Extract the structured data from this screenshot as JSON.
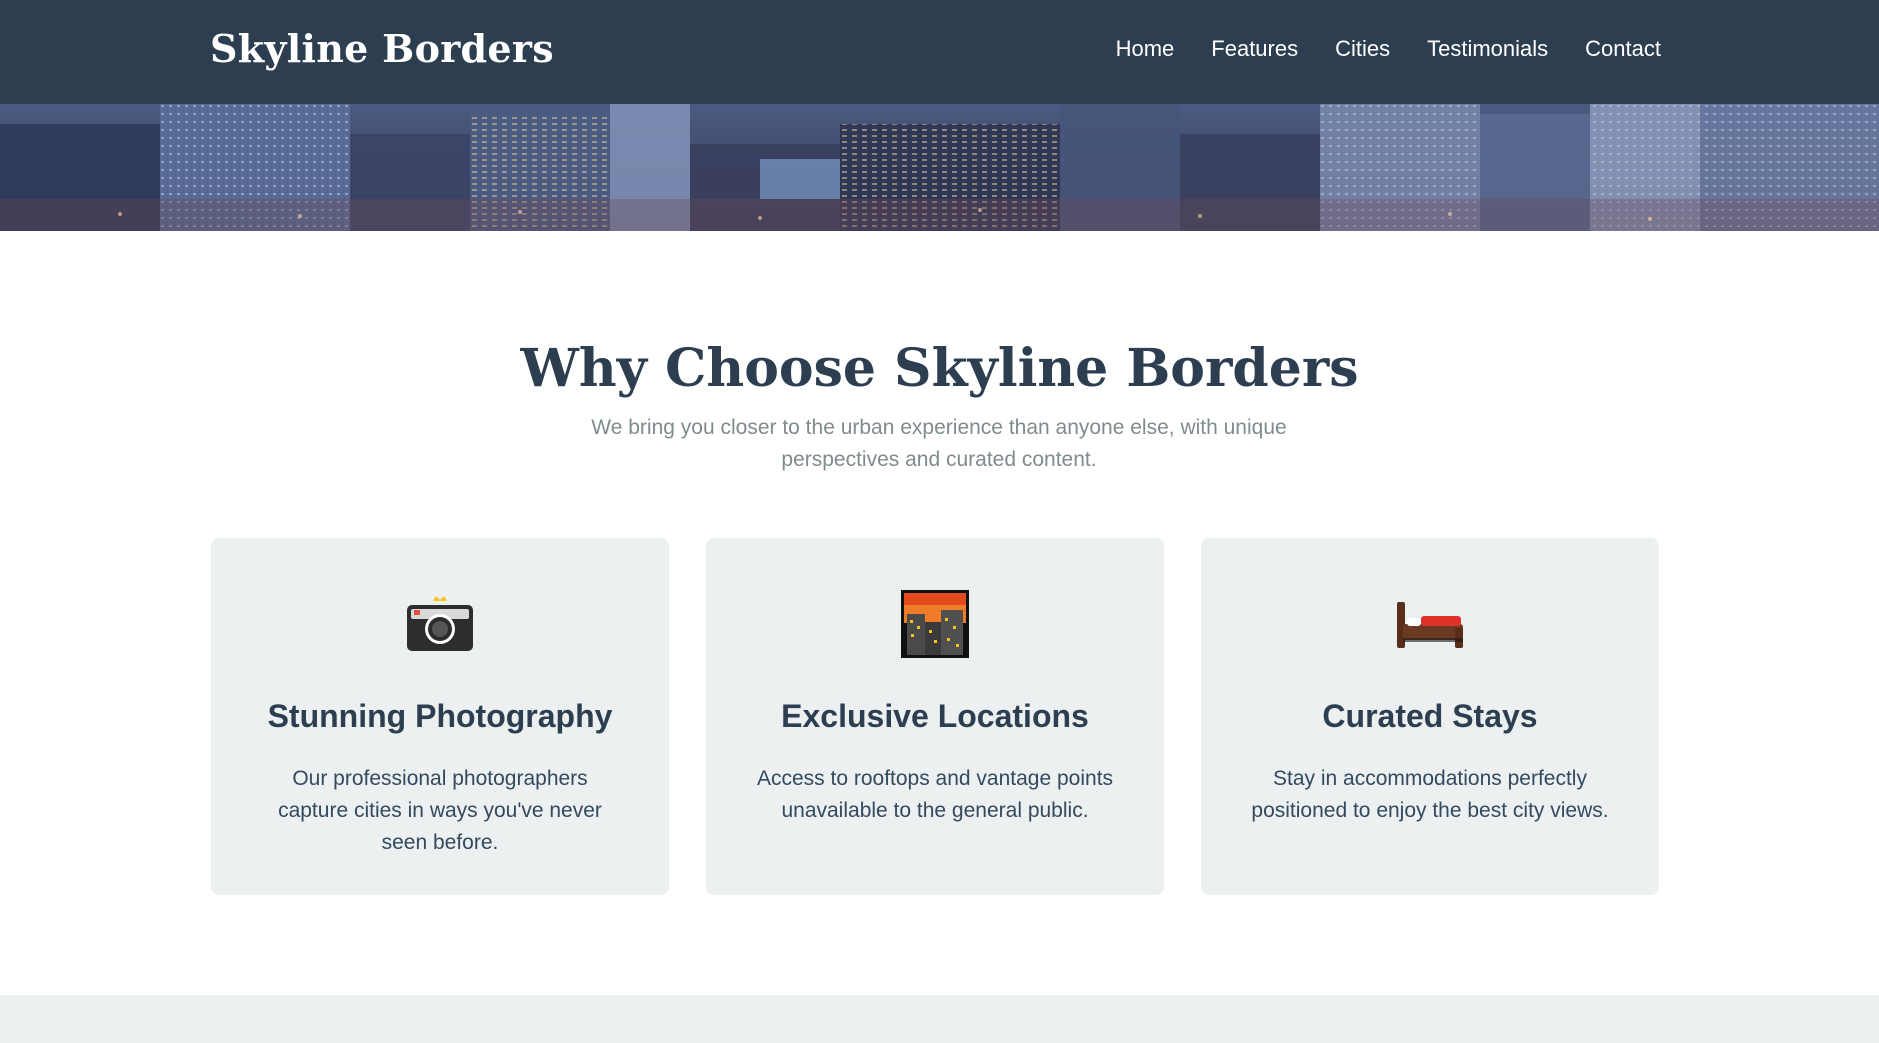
{
  "header": {
    "brand": "Skyline Borders",
    "nav": [
      "Home",
      "Features",
      "Cities",
      "Testimonials",
      "Contact"
    ]
  },
  "colors": {
    "header_bg": "#2c3e50",
    "card_bg": "#ecf0f1",
    "text_dark": "#2c3e50",
    "text_muted": "#7f8c8d"
  },
  "features": {
    "title": "Why Choose Skyline Borders",
    "subtitle": "We bring you closer to the urban experience than anyone else, with unique perspectives and curated content.",
    "cards": [
      {
        "icon": "camera-icon",
        "title": "Stunning Photography",
        "text": "Our professional photographers capture cities in ways you've never seen before."
      },
      {
        "icon": "cityscape-icon",
        "title": "Exclusive Locations",
        "text": "Access to rooftops and vantage points unavailable to the general public."
      },
      {
        "icon": "bed-icon",
        "title": "Curated Stays",
        "text": "Stay in accommodations perfectly positioned to enjoy the best city views."
      }
    ]
  }
}
